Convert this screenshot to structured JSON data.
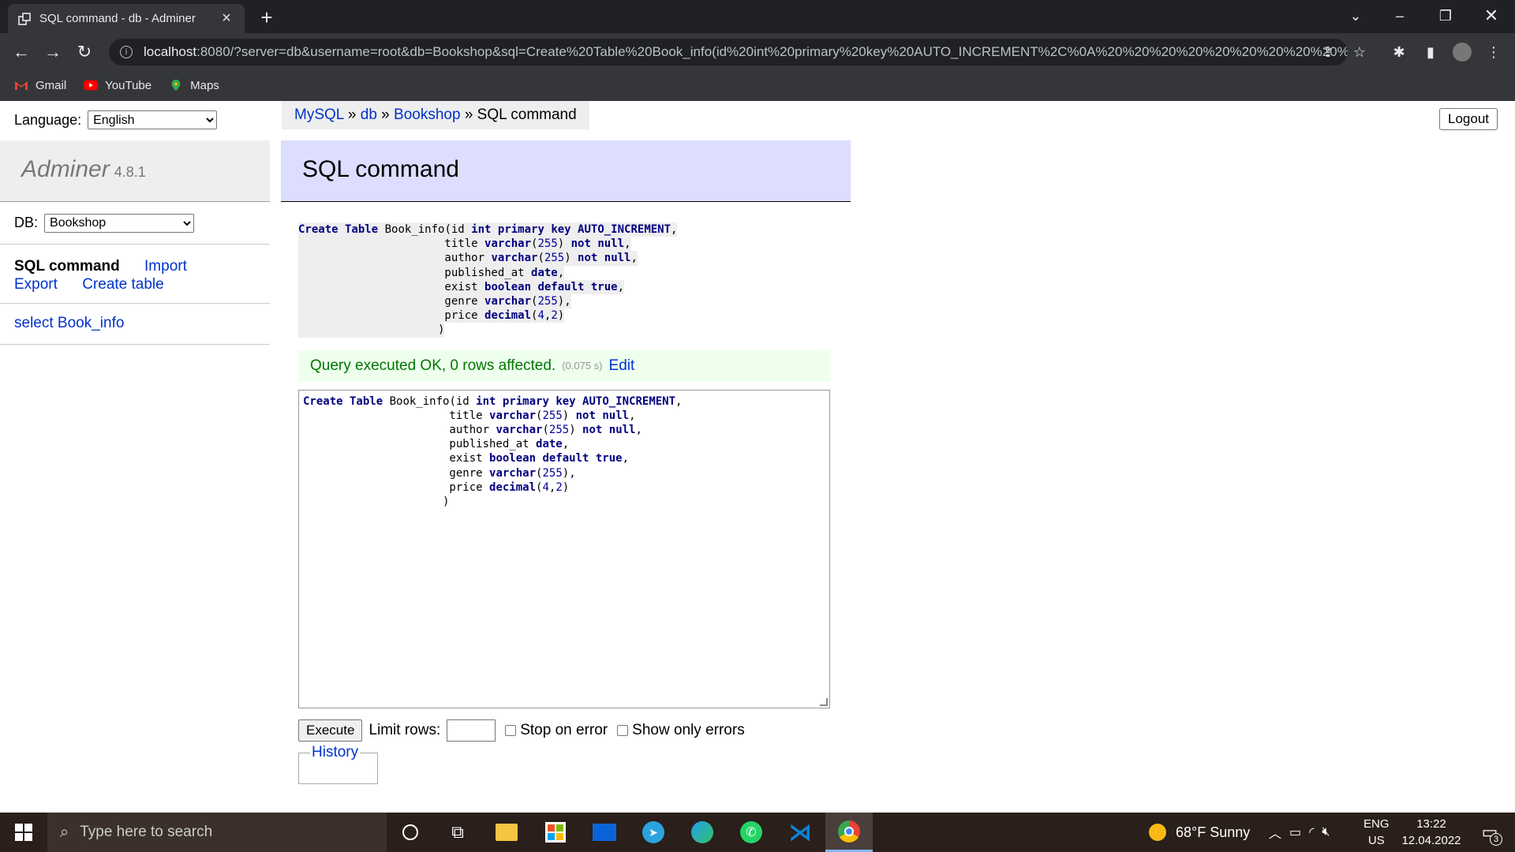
{
  "browser": {
    "tab_title": "SQL command - db - Adminer",
    "url_host": "localhost",
    "url_rest": ":8080/?server=db&username=root&db=Bookshop&sql=Create%20Table%20Book_info(id%20int%20primary%20key%20AUTO_INCREMENT%2C%0A%20%20%20%20%20%20%20%20%20%20%...",
    "bookmarks": [
      "Gmail",
      "YouTube",
      "Maps"
    ]
  },
  "lang": {
    "label": "Language:",
    "selected": "English"
  },
  "adminer": {
    "name": "Adminer",
    "version": "4.8.1"
  },
  "db": {
    "label": "DB:",
    "selected": "Bookshop"
  },
  "links": {
    "sql": "SQL command",
    "import": "Import",
    "export": "Export",
    "create_table": "Create table"
  },
  "tables": {
    "select": "select Book_info"
  },
  "breadcrumb": {
    "mysql": "MySQL",
    "sep1": " » ",
    "db": "db",
    "sep2": " » ",
    "bookshop": "Bookshop",
    "sep3": " » ",
    "current": "SQL command"
  },
  "logout": "Logout",
  "title": "SQL command",
  "message": {
    "text": "Query executed OK, 0 rows affected.",
    "time": "(0.075 s)",
    "edit": "Edit"
  },
  "sql_lines": [
    "Create Table Book_info(id int primary key AUTO_INCREMENT,",
    "                      title varchar(255) not null,",
    "                      author varchar(255) not null,",
    "                      published_at date,",
    "                      exist boolean default true,",
    "                      genre varchar(255),",
    "                      price decimal(4,2)",
    "                     )"
  ],
  "exec": {
    "button": "Execute",
    "limit_label": "Limit rows:",
    "stop_on_error": "Stop on error",
    "show_only_errors": "Show only errors"
  },
  "history": "History",
  "taskbar": {
    "search_placeholder": "Type here to search",
    "weather": "68°F  Sunny",
    "lang1": "ENG",
    "lang2": "US",
    "time": "13:22",
    "date": "12.04.2022",
    "notif": "3"
  }
}
